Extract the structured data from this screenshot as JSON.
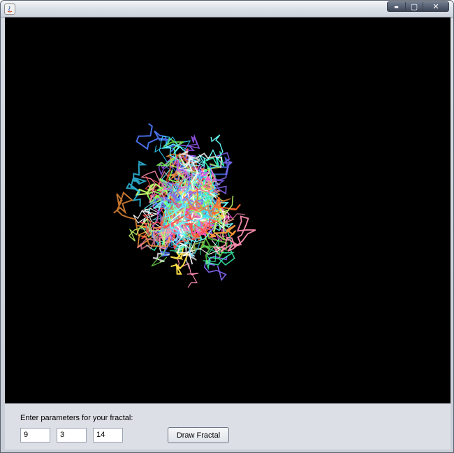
{
  "window": {
    "title": "",
    "controls": {
      "minimize": "▬",
      "maximize": "▢",
      "close": "✕"
    }
  },
  "panel": {
    "prompt": "Enter parameters for your fractal:",
    "fields": [
      "9",
      "3",
      "14"
    ],
    "draw_button": "Draw Fractal"
  },
  "fractal": {
    "palette": [
      "#ff4d4d",
      "#ff9a3c",
      "#ffe04a",
      "#7dff5a",
      "#3cffb5",
      "#35d6ff",
      "#4f7bff",
      "#a15bff",
      "#ff4fd8",
      "#ff8fb0",
      "#c8ff6a",
      "#6affff",
      "#ffffff",
      "#ff6a2a",
      "#8a6bff"
    ]
  }
}
